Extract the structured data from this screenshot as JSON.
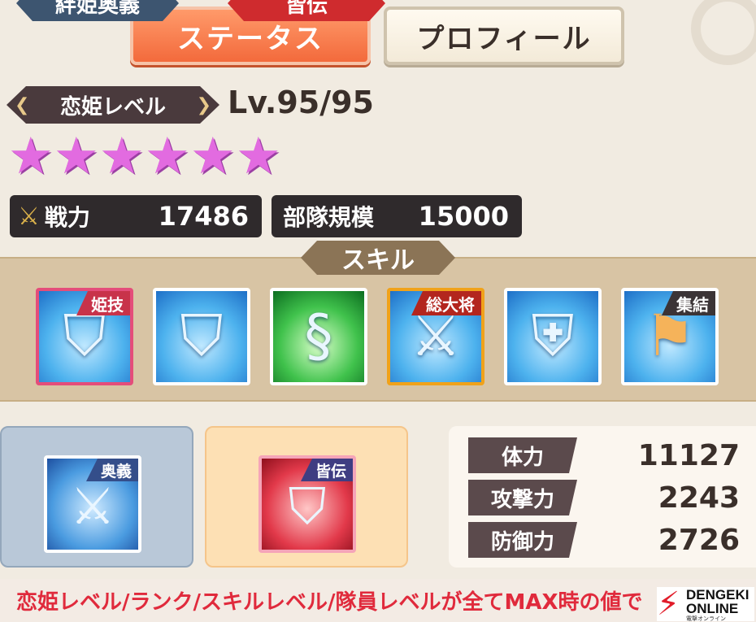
{
  "tabs": {
    "status": "ステータス",
    "profile": "プロフィール"
  },
  "level": {
    "label": "恋姫レベル",
    "value": "Lv.95/95"
  },
  "rank_stars": 6,
  "power": {
    "label": "戦力",
    "value": "17486"
  },
  "troop": {
    "label": "部隊規模",
    "value": "15000"
  },
  "skills": {
    "title": "スキル",
    "icons": [
      {
        "name": "shield-skill-icon",
        "tag": "姫技"
      },
      {
        "name": "shield-skill-icon",
        "tag": ""
      },
      {
        "name": "wind-skill-icon",
        "tag": ""
      },
      {
        "name": "crossed-swords-skill-icon",
        "tag": "総大将"
      },
      {
        "name": "armor-skill-icon",
        "tag": ""
      },
      {
        "name": "flag-skill-icon",
        "tag": "集結"
      }
    ]
  },
  "bond": {
    "title": "絆姫奥義",
    "tag": "奥義"
  },
  "kaiden": {
    "title": "皆伝",
    "tag": "皆伝"
  },
  "stats": [
    {
      "label": "体力",
      "value": "11127"
    },
    {
      "label": "攻撃力",
      "value": "2243"
    },
    {
      "label": "防御力",
      "value": "2726"
    }
  ],
  "footer_note": "恋姫レベル/ランク/スキルレベル/隊員レベルが全てMAX時の値で",
  "logo": {
    "line1": "DENGEKI",
    "line2": "ONLINE",
    "line3": "電撃オンライン"
  },
  "colors": {
    "accent_tab": "#f36a3c",
    "star": "#e26be0",
    "note": "#e02a3c"
  }
}
